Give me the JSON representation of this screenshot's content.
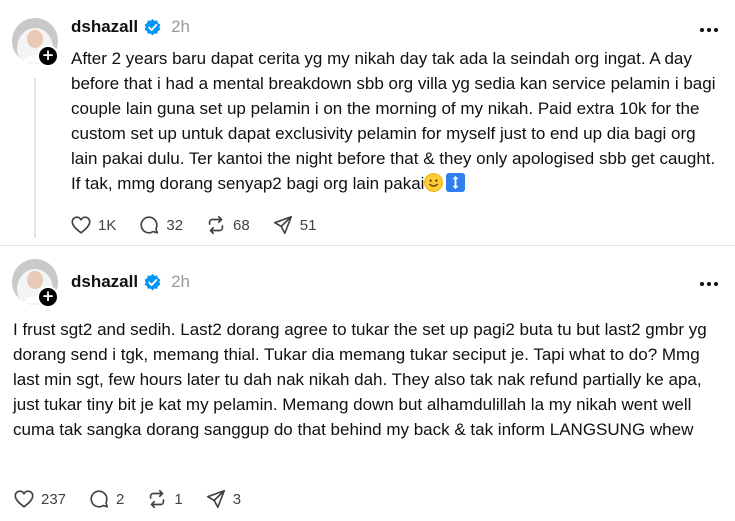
{
  "colors": {
    "verified": "#0095f6",
    "muted": "#999999",
    "text": "#101010",
    "icon": "#424242"
  },
  "posts": [
    {
      "username": "dshazall",
      "time": "2h",
      "text": "After 2 years baru dapat cerita yg my nikah day tak ada la seindah org ingat. A day before that i had a mental breakdown sbb org villa yg sedia kan service pelamin i bagi couple lain guna set up pelamin i on the morning of my nikah. Paid extra 10k for the custom set up untuk dapat exclusivity pelamin for myself just to end up dia bagi org lain pakai dulu. Ter kantoi the night before that & they only apologised sbb get caught. If tak, mmg dorang senyap2 bagi org lain pakai",
      "trailing_icons": [
        "slightly-smiling-face-emoji",
        "up-down-arrow-emoji"
      ],
      "likes": "1K",
      "replies": "32",
      "reposts": "68",
      "shares": "51"
    },
    {
      "username": "dshazall",
      "time": "2h",
      "text": "I frust sgt2 and sedih. Last2 dorang agree to tukar the set up pagi2 buta tu but last2 gmbr yg dorang send i tgk, memang thial. Tukar dia memang tukar seciput je. Tapi what to do? Mmg last min sgt, few hours later tu dah nak nikah dah. They also tak nak refund partially ke apa, just tukar tiny bit je kat my pelamin. Memang down but alhamdulillah la my nikah went well cuma tak sangka dorang sanggup do that behind my back & tak inform LANGSUNG whew",
      "likes": "237",
      "replies": "2",
      "reposts": "1",
      "shares": "3"
    }
  ]
}
